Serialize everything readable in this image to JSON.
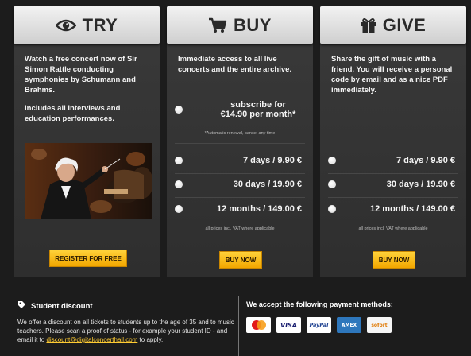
{
  "colors": {
    "background": "#1c1c1c",
    "panel": "#333333",
    "header": "#e2e2e2",
    "cta": "#f6b800",
    "link": "#ffcc33"
  },
  "try": {
    "title": "TRY",
    "icon": "eye-icon",
    "desc1": "Watch a free concert now of Sir Simon Rattle conducting symphonies by Schumann and Brahms.",
    "desc2": "Includes all interviews and education performances.",
    "image": "conductor-orchestra-photo",
    "button": "REGISTER FOR FREE"
  },
  "buy": {
    "title": "BUY",
    "icon": "shopping-cart-icon",
    "desc": "Immediate access to all live concerts and the entire archive.",
    "subscribe_line1": "subscribe for",
    "subscribe_line2": "€14.90 per month*",
    "renewal_note": "*Automatic renewal, cancel any time",
    "options": [
      "7 days / 9.90 €",
      "30 days / 19.90 €",
      "12 months / 149.00 €"
    ],
    "vat_note": "all prices incl. VAT where applicable",
    "button": "BUY NOW"
  },
  "give": {
    "title": "GIVE",
    "icon": "gift-icon",
    "desc": "Share the gift of music with a friend. You will receive a personal code by email and as a nice PDF immediately.",
    "options": [
      "7 days / 9.90 €",
      "30 days / 19.90 €",
      "12 months / 149.00 €"
    ],
    "vat_note": "all prices incl. VAT where applicable",
    "button": "BUY NOW"
  },
  "footer": {
    "student_title": "Student discount",
    "student_icon": "tag-icon",
    "student_text": "We offer a discount on all tickets to students up to the age of 35 and to music teachers. Please scan a proof of status - for example your student ID - and email it to",
    "student_email": "discount@digitalconcerthall.com",
    "student_text_end": "to apply.",
    "payment_title": "We accept the following payment methods:",
    "payment_methods": [
      "MasterCard",
      "VISA",
      "PayPal",
      "AMEX",
      "sofort"
    ]
  }
}
